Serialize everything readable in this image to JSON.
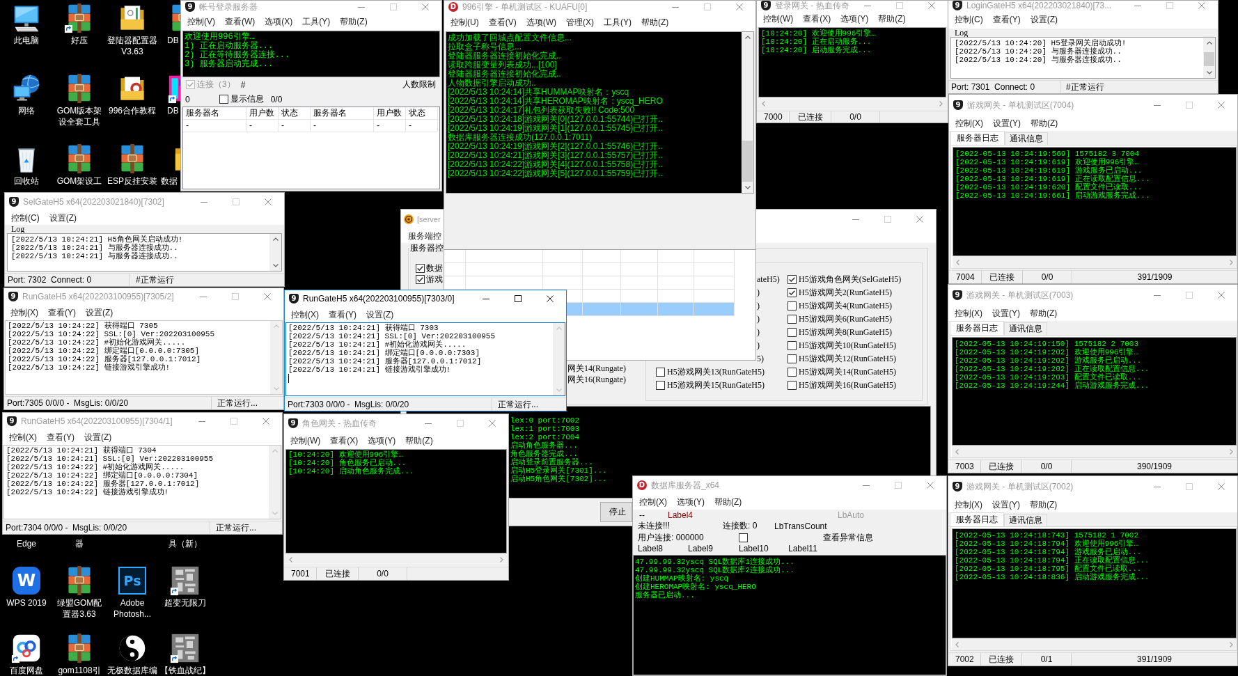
{
  "desktop_icons": [
    {
      "label": "此电脑"
    },
    {
      "label": "好压"
    },
    {
      "label": "登陆器配置器 V3.63"
    },
    {
      "label": "DB"
    },
    {
      "label": "网络"
    },
    {
      "label": "GOM版本架设全套工具"
    },
    {
      "label": "996合作教程"
    },
    {
      "label": "DB"
    },
    {
      "label": "回收站"
    },
    {
      "label": "GOM架设工"
    },
    {
      "label": "ESP反挂安装"
    },
    {
      "label": "数据"
    },
    {
      "label": "Edge"
    },
    {
      "label": "器"
    },
    {
      "label": "具（新）"
    },
    {
      "label": "WPS 2019",
      "logo_text": "W"
    },
    {
      "label": "绿盟GOM配置器3.63"
    },
    {
      "label": "Adobe Photosh...",
      "logo_text": "Ps"
    },
    {
      "label": "超变无限刀"
    },
    {
      "label": "百度网盘"
    },
    {
      "label": "gom1108引"
    },
    {
      "label": "无极数据库编"
    },
    {
      "label": "【铁血战纪】"
    }
  ],
  "windows": [
    {
      "kind": "account",
      "title": "帐号登录服务器",
      "logo_text": "9",
      "active": false,
      "menu": [
        "控制(V)",
        "查看(W)",
        "选项(X)",
        "工具(Y)",
        "帮助(Z)"
      ],
      "log": [
        "欢迎使用996引擎…",
        "1) 正在启动服务器...",
        "2) 正在等待服务器连接...",
        "3) 服务器启动完成..."
      ],
      "connect": {
        "label": "连接（3）",
        "checked": true,
        "disabled": true
      },
      "hash": "#",
      "limit_label": "人数限制",
      "count": "0",
      "show_info": {
        "label": "显示信息",
        "checked": false
      },
      "ratio": "0/0",
      "table": {
        "columns": [
          "服务器名",
          "用户数",
          "状态",
          "服务器名",
          "用户数",
          "状态"
        ],
        "rows": [
          [
            "-",
            "-",
            "-",
            "-",
            "-",
            "-"
          ]
        ]
      }
    },
    {
      "kind": "engine",
      "title": "996引擎 - 单机测试区 - KUAFU[0]",
      "logo_text": "D",
      "active": false,
      "menu": [
        "控制(U)",
        "查看(V)",
        "选项(W)",
        "管理(X)",
        "工具(Y)",
        "帮助(Z)"
      ],
      "log": [
        "成功加载了回城点配置文件信息...",
        "拉取盒子称号信息...",
        "登陆器服务器连接初始化完成..",
        "读取跨服变量列表成功...[100]",
        "登陆器服务器连接初始化完成..",
        "人物数据引擎启动成功..",
        "[2022/5/13 10:24:14]共享HUMMAP映射名：yscq",
        "[2022/5/13 10:24:14]共享HEROMAP映射名：yscq_HERO",
        "[2022/5/13 10:24:17]礼包列表获取失败!! Code:500",
        "[2022/5/13 10:24:18]游戏网关[0](127.0.0.1:55744)已打开..",
        "[2022/5/13 10:24:19]游戏网关[1](127.0.0.1:55745)已打开..",
        "数据库服务器连接成功(127.0.0.1:7011)",
        "[2022/5/13 10:24:19]游戏网关[2](127.0.0.1:55746)已打开..",
        "[2022/5/13 10:24:21]游戏网关[3](127.0.0.1:55757)已打开..",
        "[2022/5/13 10:24:22]游戏网关[4](127.0.0.1:55758)已打开..",
        "[2022/5/13 10:24:22]游戏网关[5](127.0.0.1:55759)已打开.."
      ],
      "grid": {
        "rows": [
          {
            "selected": false
          },
          {
            "selected": false
          },
          {
            "selected": false
          },
          {
            "selected": false
          },
          {
            "selected": true
          }
        ]
      }
    },
    {
      "kind": "gate_console",
      "title": "登录网关 - 热血传奇",
      "logo_text": "9",
      "active": false,
      "menu": [
        "控制(W)",
        "查看(X)",
        "选项(Y)",
        "帮助(Z)"
      ],
      "log": [
        "[10:24:20] 欢迎使用996引擎…",
        "[10:24:20] 正在启动服务...",
        "[10:24:20] 启动服务完成..."
      ],
      "status": [
        "7000",
        "已连接",
        "0/0"
      ]
    },
    {
      "kind": "log_gate",
      "title": "LoginGateH5 x64(202203021840)[73...",
      "logo_text": "9",
      "active": false,
      "menu": [
        "控制(C)",
        "查看(Y)",
        "设置(Z)"
      ],
      "log_label": "Log",
      "log": [
        "[2022/5/13 10:24:20] H5登录网关启动成功!",
        "[2022/5/13 10:24:20] 与服务器连接成功..",
        "[2022/5/13 10:24:20] 与服务器连接成功.."
      ],
      "status": [
        "Port: 7301  Connect: 0",
        "#正常运行"
      ]
    },
    {
      "kind": "log_gate",
      "title": "SelGateH5 x64(202203021840)[7302]",
      "logo_text": "9",
      "active": false,
      "menu": [
        "控制(C)",
        "设置(Z)"
      ],
      "log_label": "Log",
      "log": [
        "[2022/5/13 10:24:21] H5角色网关启动成功!",
        "[2022/5/13 10:24:21] 与服务器连接成功..",
        "[2022/5/13 10:24:21] 与服务器连接成功.."
      ],
      "status": [
        "Port: 7302  Connect: 0",
        "#正常运行"
      ]
    },
    {
      "kind": "server_control",
      "title": "[server",
      "active": false,
      "menu": [
        "服务端控"
      ],
      "group_label": "服务器控",
      "left_checks": [
        {
          "label": "数据",
          "checked": true
        },
        {
          "label": "游戏",
          "checked": true
        }
      ],
      "gate_fragments": [
        "网关14(Rungate)",
        "网关16(Rungate)"
      ],
      "inner_left": [
        {
          "kind": "fragment",
          "label": "ateH5)"
        },
        {
          "kind": "fragment",
          "label": ")"
        },
        {
          "kind": "fragment",
          "label": ")"
        },
        {
          "kind": "fragment",
          "label": ")"
        },
        {
          "kind": "fragment",
          "label": ")"
        },
        {
          "kind": "fragment",
          "label": ")"
        },
        {
          "kind": "fragment",
          "label": "5)"
        },
        {
          "kind": "checkbox",
          "label": "H5游戏网关13(RunGateH5)",
          "checked": false
        },
        {
          "kind": "checkbox",
          "label": "H5游戏网关15(RunGateH5)",
          "checked": false
        }
      ],
      "inner_right": [
        {
          "kind": "checkbox",
          "label": "H5游戏角色网关(SelGateH5)",
          "checked": true
        },
        {
          "kind": "checkbox",
          "label": "H5游戏网关2(RunGateH5)",
          "checked": true
        },
        {
          "kind": "checkbox",
          "label": "H5游戏网关4(RunGateH5)",
          "checked": false
        },
        {
          "kind": "checkbox",
          "label": "H5游戏网关6(RunGateH5)",
          "checked": false
        },
        {
          "kind": "checkbox",
          "label": "H5游戏网关8(RunGateH5)",
          "checked": false
        },
        {
          "kind": "checkbox",
          "label": "H5游戏网关10(RunGateH5)",
          "checked": false
        },
        {
          "kind": "checkbox",
          "label": "H5游戏网关12(RunGateH5)",
          "checked": false
        },
        {
          "kind": "checkbox",
          "label": "H5游戏网关14(RunGateH5)",
          "checked": false
        },
        {
          "kind": "checkbox",
          "label": "H5游戏网关16(RunGateH5)",
          "checked": false
        }
      ],
      "log": [
        "lex:0 port:7002",
        "lex:1 port:7003",
        "lex:2 port:7004",
        "启动角色服务器...",
        "角色服务器完成...",
        "启动登录前置服务器...",
        "启动H5登录网关[7301]...",
        "启动H5角色网关[7302]..."
      ],
      "button": "停止"
    },
    {
      "kind": "game_gate",
      "title": "游戏网关 - 单机测试区(7004)",
      "logo_text": "9",
      "active": false,
      "menu": [
        "控制(X)",
        "设置(Y)",
        "帮助(Z)"
      ],
      "tabs": [
        {
          "label": "服务器日志",
          "selected": true
        },
        {
          "label": "通讯信息",
          "selected": false
        }
      ],
      "log": [
        "[2022-05-13 10:24:19:569] 1575182 3 7004",
        "[2022-05-13 10:24:19:619] 欢迎使用996引擎…",
        "[2022-05-13 10:24:19:619] 游戏服务已启动...",
        "[2022-05-13 10:24:19:619] 正在读取配置信息...",
        "[2022-05-13 10:24:19:620] 配置文件已读取...",
        "[2022-05-13 10:24:19:661] 启动游戏服务完成..."
      ],
      "status": [
        "7004",
        "已连接",
        "0/0",
        "391/1909"
      ]
    },
    {
      "kind": "run_gate",
      "title": "RunGateH5 x64(202203100955)[7305/2]",
      "logo_text": "9",
      "active": false,
      "menu": [
        "控制(X)",
        "查看(Y)",
        "设置(Z)"
      ],
      "log": [
        "[2022/5/13 10:24:22] 获得端口 7305",
        "[2022/5/13 10:24:22] SSL:[0] Ver:202203100955",
        "[2022/5/13 10:24:22] #初始化游戏网关.....",
        "[2022/5/13 10:24:22] 绑定端口[0.0.0.0:7305]",
        "[2022/5/13 10:24:22] 服务器[127.0.0.1:7012]",
        "[2022/5/13 10:24:22] 链接游戏引擎成功!"
      ],
      "status": [
        "Port:7305 0/0/0 -  MsgLis: 0/0/20",
        "正常运行..."
      ]
    },
    {
      "kind": "run_gate",
      "title": "RunGateH5 x64(202203100955)[7303/0]",
      "logo_text": "9",
      "active": true,
      "cursor": true,
      "menu": [
        "控制(X)",
        "查看(Y)",
        "设置(Z)"
      ],
      "log": [
        "[2022/5/13 10:24:21] 获得端口 7303",
        "[2022/5/13 10:24:21] SSL:[0] Ver:202203100955",
        "[2022/5/13 10:24:21] #初始化游戏网关.....",
        "[2022/5/13 10:24:21] 绑定端口[0.0.0.0:7303]",
        "[2022/5/13 10:24:21] 服务器[127.0.0.1:7012]",
        "[2022/5/13 10:24:21] 链接游戏引擎成功!"
      ],
      "status": [
        "Port:7303 0/0/0 -  MsgLis: 0/0/20",
        "正常运行..."
      ]
    },
    {
      "kind": "game_gate",
      "title": "游戏网关 - 单机测试区(7003)",
      "logo_text": "9",
      "active": false,
      "menu": [
        "控制(X)",
        "设置(Y)",
        "帮助(Z)"
      ],
      "tabs": [
        {
          "label": "服务器日志",
          "selected": true
        },
        {
          "label": "通讯信息",
          "selected": false
        }
      ],
      "log": [
        "[2022-05-13 10:24:19:150] 1575182 2 7003",
        "[2022-05-13 10:24:19:202] 欢迎使用996引擎…",
        "[2022-05-13 10:24:19:202] 游戏服务已启动...",
        "[2022-05-13 10:24:19:202] 正在读取配置信息...",
        "[2022-05-13 10:24:19:203] 配置文件已读取...",
        "[2022-05-13 10:24:19:244] 启动游戏服务完成..."
      ],
      "status": [
        "7003",
        "已连接",
        "0/0",
        "390/1909"
      ]
    },
    {
      "kind": "run_gate",
      "title": "RunGateH5 x64(202203100955)[7304/1]",
      "logo_text": "9",
      "active": false,
      "menu": [
        "控制(X)",
        "查看(Y)",
        "设置(Z)"
      ],
      "log": [
        "[2022/5/13 10:24:21] 获得端口 7304",
        "[2022/5/13 10:24:21] SSL:[0] Ver:202203100955",
        "[2022/5/13 10:24:22] #初始化游戏网关.....",
        "[2022/5/13 10:24:22] 绑定端口[0.0.0.0:7304]",
        "[2022/5/13 10:24:22] 服务器[127.0.0.1:7012]",
        "[2022/5/13 10:24:22] 链接游戏引擎成功!"
      ],
      "status": [
        "Port:7304 0/0/0 -  MsgLis: 0/0/20",
        "正常运行..."
      ]
    },
    {
      "kind": "gate_console",
      "title": "角色网关 - 热血传奇",
      "logo_text": "9",
      "active": false,
      "menu": [
        "控制(W)",
        "查看(X)",
        "选项(Y)",
        "帮助(Z)"
      ],
      "log": [
        "[10:24:20] 欢迎使用996引擎…",
        "[10:24:20] 角色服务已启动...",
        "[10:24:20] 启动角色服务完成..."
      ],
      "status": [
        "7001",
        "已连接",
        "0/0"
      ]
    },
    {
      "kind": "db_server",
      "title": "数据库服务器_x64",
      "logo_text": "D",
      "active": false,
      "menu": [
        "控制(X)",
        "选项(Y)",
        "帮助(Z)"
      ],
      "info_rows": [
        [
          "--",
          "Label4",
          "LbAuto"
        ],
        [
          "未连接!!!",
          "连接数: 0",
          "LbTransCount"
        ],
        [
          "用户连接: 000000"
        ],
        [
          "Label8",
          "Label9",
          "Label10",
          "Label11"
        ]
      ],
      "abnormal_check": {
        "label": "查看异常信息",
        "checked": false
      },
      "log": [
        "47.99.99.32yscq SQL数据库1连接成功...",
        "47.99.99.32yscq SQL数据库2连接成功...",
        "创建HUMMAP映射名: yscq",
        "创建HEROMAP映射名: yscq_HERO",
        "服务器已启动..."
      ]
    },
    {
      "kind": "game_gate",
      "title": "游戏网关 - 单机测试区(7002)",
      "logo_text": "9",
      "active": false,
      "menu": [
        "控制(X)",
        "设置(Y)",
        "帮助(Z)"
      ],
      "tabs": [
        {
          "label": "服务器日志",
          "selected": true
        },
        {
          "label": "通讯信息",
          "selected": false
        }
      ],
      "log": [
        "[2022-05-13 10:24:18:743] 1575182 1 7002",
        "[2022-05-13 10:24:18:794] 欢迎使用996引擎…",
        "[2022-05-13 10:24:18:794] 游戏服务已启动...",
        "[2022-05-13 10:24:18:794] 正在读取配置信息...",
        "[2022-05-13 10:24:18:795] 配置文件已读取...",
        "[2022-05-13 10:24:18:836] 启动游戏服务完成..."
      ],
      "status": [
        "7002",
        "已连接",
        "0/1",
        "391/1909"
      ]
    }
  ]
}
